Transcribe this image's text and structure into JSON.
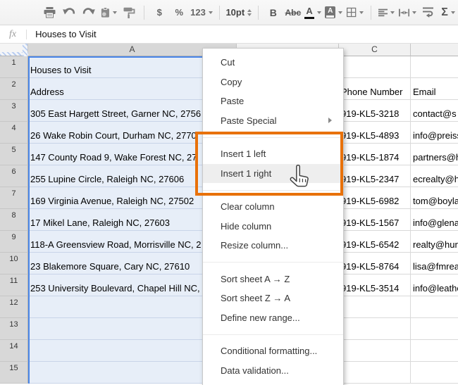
{
  "toolbar": {
    "currency": "$",
    "percent": "%",
    "number_format": "123",
    "font_size": "10pt",
    "bold": "B",
    "strikethrough": "Abc",
    "text_color": "A",
    "fill_color": "A",
    "functions": "Σ"
  },
  "formula_bar": {
    "fx": "fx",
    "value": "Houses to Visit"
  },
  "sheet": {
    "col_a_label": "A",
    "col_b_label": "",
    "col_c_label": "C",
    "col_d_label": "",
    "rows": [
      {
        "num": "1",
        "a": "Houses to Visit",
        "c": "",
        "d": ""
      },
      {
        "num": "2",
        "a": "Address",
        "c": "Phone Number",
        "d": "Email"
      },
      {
        "num": "3",
        "a": "305 East Hargett Street, Garner NC, 2756",
        "c": "919-KL5-3218",
        "d": "contact@s"
      },
      {
        "num": "4",
        "a": "26 Wake Robin Court, Durham NC, 2770",
        "c": "919-KL5-4893",
        "d": "info@preiss"
      },
      {
        "num": "5",
        "a": "147 County Road 9, Wake Forest NC, 27",
        "c": "919-KL5-1874",
        "d": "partners@h"
      },
      {
        "num": "6",
        "a": "255 Lupine Circle, Raleigh NC, 27606",
        "c": "919-KL5-2347",
        "d": "ecrealty@h"
      },
      {
        "num": "7",
        "a": "169 Virginia Avenue, Raleigh NC, 27502",
        "c": "919-KL5-6982",
        "d": "tom@boyla"
      },
      {
        "num": "8",
        "a": "17 Mikel Lane, Raleigh NC, 27603",
        "c": "919-KL5-1567",
        "d": "info@glena"
      },
      {
        "num": "9",
        "a": "118-A Greensview Road, Morrisville NC, 2",
        "c": "919-KL5-6542",
        "d": "realty@hun"
      },
      {
        "num": "10",
        "a": "23 Blakemore Square, Cary NC, 27610",
        "c": "919-KL5-8764",
        "d": "lisa@fmrea"
      },
      {
        "num": "11",
        "a": "253 University Boulevard, Chapel Hill NC,",
        "c": "919-KL5-3514",
        "d": "info@leathe"
      },
      {
        "num": "12",
        "a": "",
        "c": "",
        "d": ""
      },
      {
        "num": "13",
        "a": "",
        "c": "",
        "d": ""
      },
      {
        "num": "14",
        "a": "",
        "c": "",
        "d": ""
      },
      {
        "num": "15",
        "a": "",
        "c": "",
        "d": ""
      }
    ]
  },
  "context_menu": {
    "items": [
      "Cut",
      "Copy",
      "Paste",
      "Paste Special",
      "Insert 1 left",
      "Insert 1 right",
      "Clear column",
      "Hide column",
      "Resize column...",
      "Sort sheet A → Z",
      "Sort sheet Z → A",
      "Define new range...",
      "Conditional formatting...",
      "Data validation..."
    ]
  },
  "colors": {
    "highlight_orange": "#e8710a",
    "selection_blue": "#4a86e8",
    "selected_fill": "#e7eef8"
  }
}
